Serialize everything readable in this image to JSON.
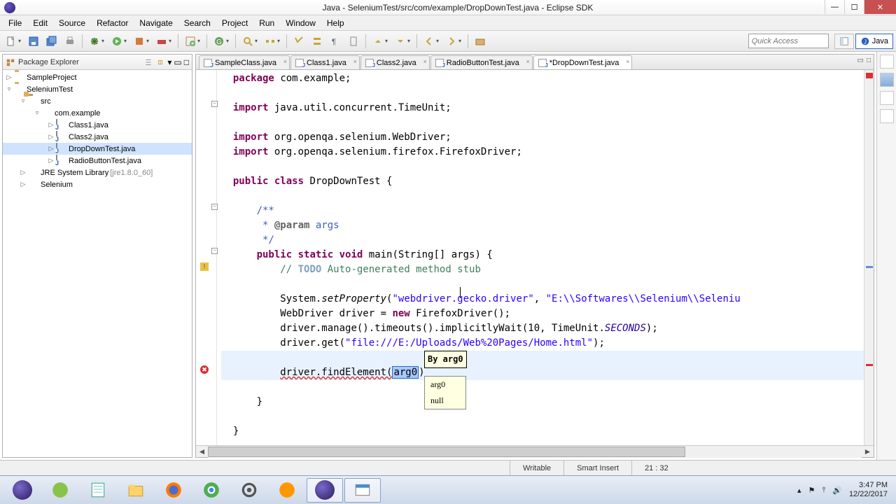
{
  "window": {
    "title": "Java - SeleniumTest/src/com/example/DropDownTest.java - Eclipse SDK"
  },
  "menu": [
    "File",
    "Edit",
    "Source",
    "Refactor",
    "Navigate",
    "Search",
    "Project",
    "Run",
    "Window",
    "Help"
  ],
  "quick_access_placeholder": "Quick Access",
  "perspective_label": "Java",
  "explorer": {
    "title": "Package Explorer",
    "projects": [
      {
        "name": "SampleProject",
        "expanded": false
      },
      {
        "name": "SeleniumTest",
        "expanded": true,
        "children": [
          {
            "type": "src",
            "name": "src",
            "expanded": true,
            "children": [
              {
                "type": "pkg",
                "name": "com.example",
                "expanded": true,
                "children": [
                  {
                    "type": "java",
                    "name": "Class1.java"
                  },
                  {
                    "type": "java",
                    "name": "Class2.java"
                  },
                  {
                    "type": "java",
                    "name": "DropDownTest.java",
                    "selected": true
                  },
                  {
                    "type": "java",
                    "name": "RadioButtonTest.java"
                  }
                ]
              }
            ]
          },
          {
            "type": "lib",
            "name": "JRE System Library",
            "suffix": "[jre1.8.0_60]"
          },
          {
            "type": "lib",
            "name": "Selenium"
          }
        ]
      }
    ]
  },
  "editor": {
    "tabs": [
      {
        "label": "SampleClass.java"
      },
      {
        "label": "Class1.java"
      },
      {
        "label": "Class2.java"
      },
      {
        "label": "RadioButtonTest.java"
      },
      {
        "label": "*DropDownTest.java",
        "active": true
      }
    ],
    "code": {
      "package_kw": "package",
      "package_name": "com.example;",
      "import_kw": "import",
      "imp1": "java.util.concurrent.TimeUnit;",
      "imp2": "org.openqa.selenium.WebDriver;",
      "imp3": "org.openqa.selenium.firefox.FirefoxDriver;",
      "public_kw": "public",
      "class_kw": "class",
      "class_name": "DropDownTest {",
      "doc1": "/**",
      "doc2": " * ",
      "doc_tag": "@param",
      "doc_tag_arg": " args",
      "doc3": " */",
      "static_kw": "static",
      "void_kw": "void",
      "main_sig": "main(String[] args) {",
      "todo": "// ",
      "todo_tag": "TODO",
      "todo_rest": " Auto-generated method stub",
      "line_sys": "System.",
      "setProperty": "setProperty",
      "sys_args": "(",
      "s1": "\"webdriver.gecko.driver\"",
      ", ": " , ",
      "s2": "\"E:\\\\Softwares\\\\Selenium\\\\Seleniu",
      "line_wd": "WebDriver driver = ",
      "new_kw": "new",
      "wd_rest": " FirefoxDriver();",
      "line_to": "driver.manage().timeouts().implicitlyWait(10, TimeUnit.",
      "seconds": "SECONDS",
      "to_end": ");",
      "line_get": "driver.get(",
      "s3": "\"file:///E:/Uploads/Web%20Pages/Home.html\"",
      "get_end": ");",
      "line_find_pre": "driver.findElement(",
      "arg_sel": "arg0",
      "line_find_post": ")",
      "brace1": "}",
      "brace2": "}"
    },
    "param_hint": "By arg0",
    "suggestions": [
      "arg0",
      "null"
    ]
  },
  "status": {
    "writable": "Writable",
    "insert": "Smart Insert",
    "pos": "21 : 32"
  },
  "tray": {
    "time": "3:47 PM",
    "date": "12/22/2017"
  }
}
